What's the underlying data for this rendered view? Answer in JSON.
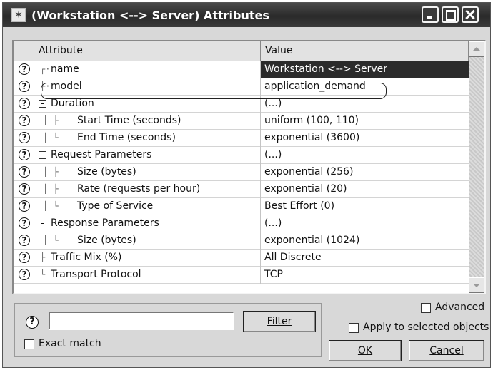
{
  "window": {
    "title": "(Workstation <--> Server) Attributes"
  },
  "grid": {
    "columns": {
      "attribute": "Attribute",
      "value": "Value"
    },
    "rows": [
      {
        "attribute": "name",
        "value": "Workstation <--> Server",
        "selected": true
      },
      {
        "attribute": "model",
        "value": "application_demand",
        "highlighted": true
      },
      {
        "attribute": "Duration",
        "value": "(...)",
        "expandable": true
      },
      {
        "attribute": "Start Time (seconds)",
        "value": "uniform (100, 110)"
      },
      {
        "attribute": "End Time (seconds)",
        "value": "exponential (3600)"
      },
      {
        "attribute": "Request Parameters",
        "value": "(...)",
        "expandable": true
      },
      {
        "attribute": "Size (bytes)",
        "value": "exponential (256)"
      },
      {
        "attribute": "Rate (requests per hour)",
        "value": "exponential (20)"
      },
      {
        "attribute": "Type of Service",
        "value": "Best Effort (0)"
      },
      {
        "attribute": "Response Parameters",
        "value": "(...)",
        "expandable": true
      },
      {
        "attribute": "Size (bytes)",
        "value": "exponential (1024)"
      },
      {
        "attribute": "Traffic Mix (%)",
        "value": "All Discrete"
      },
      {
        "attribute": "Transport Protocol",
        "value": "TCP"
      }
    ],
    "help_glyph": "?"
  },
  "filter": {
    "help_glyph": "?",
    "input_value": "",
    "filter_button": "Filter",
    "exact_match_label": "Exact match",
    "exact_match_checked": false
  },
  "options": {
    "advanced_label": "Advanced",
    "advanced_checked": false,
    "apply_label": "Apply to selected objects",
    "apply_checked": false
  },
  "buttons": {
    "ok": "OK",
    "cancel": "Cancel"
  }
}
